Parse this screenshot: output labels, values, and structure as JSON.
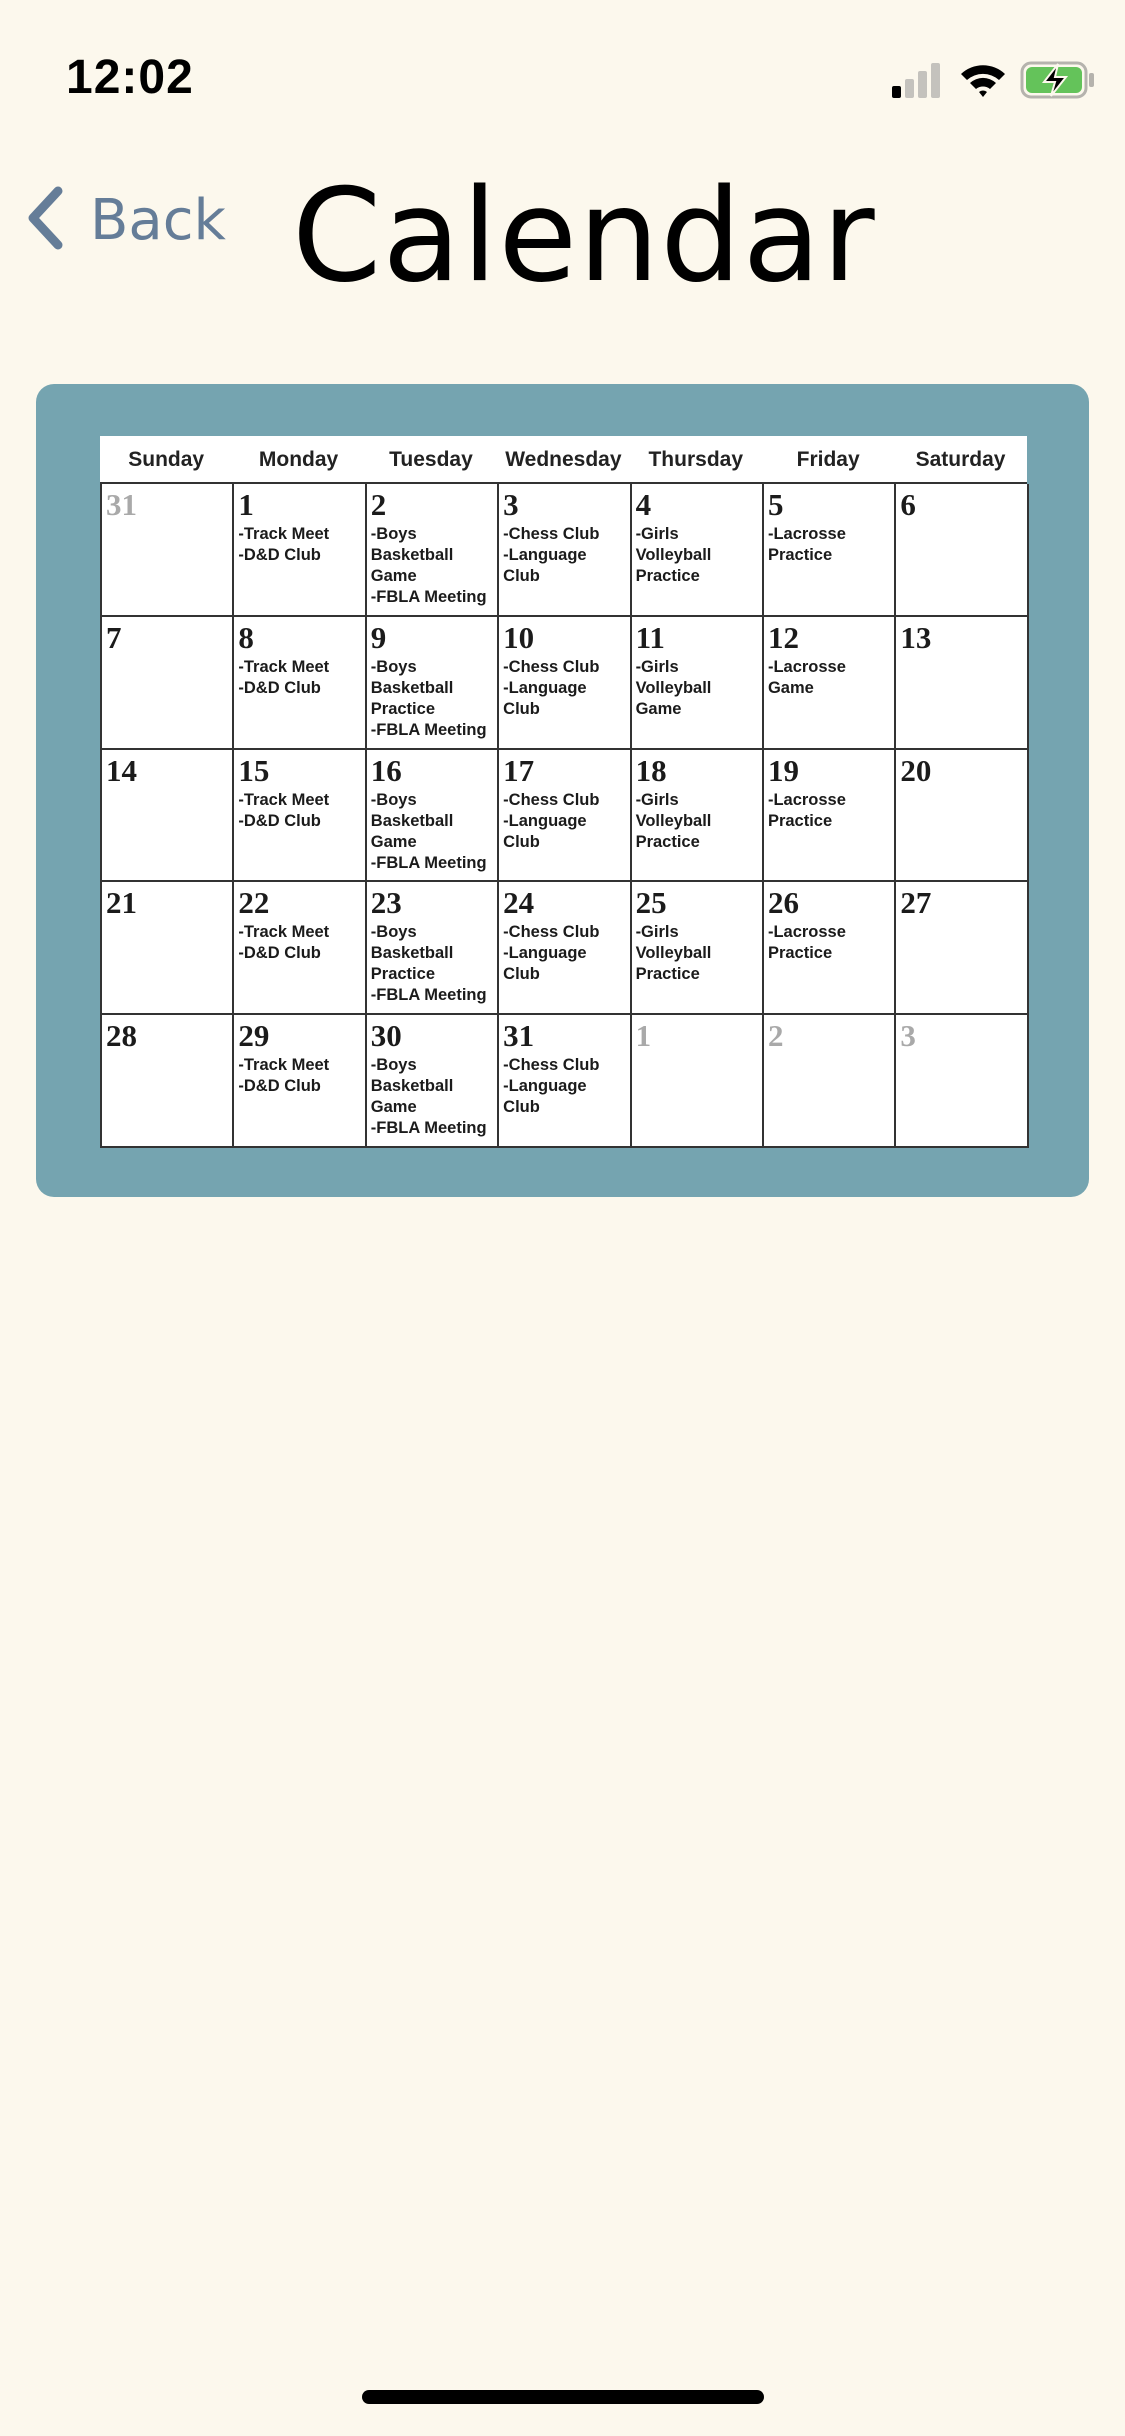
{
  "status": {
    "time": "12:02",
    "signal_bars": 4,
    "signal_bars_active": 1,
    "wifi_icon": "wifi-icon",
    "battery_icon": "battery-charging-icon",
    "battery_color": "#64c35a"
  },
  "nav": {
    "back_label": "Back",
    "back_icon": "chevron-left-icon",
    "title": "Calendar",
    "accent": "#657d98"
  },
  "calendar": {
    "card_color": "#75a4b0",
    "weekdays": [
      "Sunday",
      "Monday",
      "Tuesday",
      "Wednesday",
      "Thursday",
      "Friday",
      "Saturday"
    ],
    "weeks": [
      [
        {
          "day": "31",
          "muted": true,
          "events": []
        },
        {
          "day": "1",
          "events": [
            "-Track Meet",
            "-D&D Club"
          ]
        },
        {
          "day": "2",
          "events": [
            "-Boys Basketball Game",
            "-FBLA Meeting"
          ]
        },
        {
          "day": "3",
          "events": [
            "-Chess Club",
            "-Language Club"
          ]
        },
        {
          "day": "4",
          "events": [
            "-Girls Volleyball Practice"
          ]
        },
        {
          "day": "5",
          "events": [
            "-Lacrosse Practice"
          ]
        },
        {
          "day": "6",
          "events": []
        }
      ],
      [
        {
          "day": "7",
          "events": []
        },
        {
          "day": "8",
          "events": [
            "-Track Meet",
            "-D&D Club"
          ]
        },
        {
          "day": "9",
          "events": [
            "-Boys Basketball Practice",
            "-FBLA Meeting"
          ]
        },
        {
          "day": "10",
          "events": [
            "-Chess Club",
            "-Language Club"
          ]
        },
        {
          "day": "11",
          "events": [
            "-Girls Volleyball Game"
          ]
        },
        {
          "day": "12",
          "events": [
            "-Lacrosse Game"
          ]
        },
        {
          "day": "13",
          "events": []
        }
      ],
      [
        {
          "day": "14",
          "events": []
        },
        {
          "day": "15",
          "events": [
            "-Track Meet",
            "-D&D Club"
          ]
        },
        {
          "day": "16",
          "events": [
            "-Boys Basketball Game",
            "-FBLA Meeting"
          ]
        },
        {
          "day": "17",
          "events": [
            "-Chess Club",
            "-Language Club"
          ]
        },
        {
          "day": "18",
          "events": [
            "-Girls Volleyball Practice"
          ]
        },
        {
          "day": "19",
          "events": [
            "-Lacrosse Practice"
          ]
        },
        {
          "day": "20",
          "events": []
        }
      ],
      [
        {
          "day": "21",
          "events": []
        },
        {
          "day": "22",
          "events": [
            "-Track Meet",
            "-D&D Club"
          ]
        },
        {
          "day": "23",
          "events": [
            "-Boys Basketball Practice",
            "-FBLA Meeting"
          ]
        },
        {
          "day": "24",
          "events": [
            "-Chess Club",
            "-Language Club"
          ]
        },
        {
          "day": "25",
          "events": [
            "-Girls Volleyball Practice"
          ]
        },
        {
          "day": "26",
          "events": [
            "-Lacrosse Practice"
          ]
        },
        {
          "day": "27",
          "events": []
        }
      ],
      [
        {
          "day": "28",
          "events": []
        },
        {
          "day": "29",
          "events": [
            "-Track Meet",
            "-D&D Club"
          ]
        },
        {
          "day": "30",
          "events": [
            "-Boys Basketball Game",
            "-FBLA Meeting"
          ]
        },
        {
          "day": "31",
          "events": [
            "-Chess Club",
            "-Language Club"
          ]
        },
        {
          "day": "1",
          "muted": true,
          "events": []
        },
        {
          "day": "2",
          "muted": true,
          "events": []
        },
        {
          "day": "3",
          "muted": true,
          "events": []
        }
      ]
    ]
  }
}
